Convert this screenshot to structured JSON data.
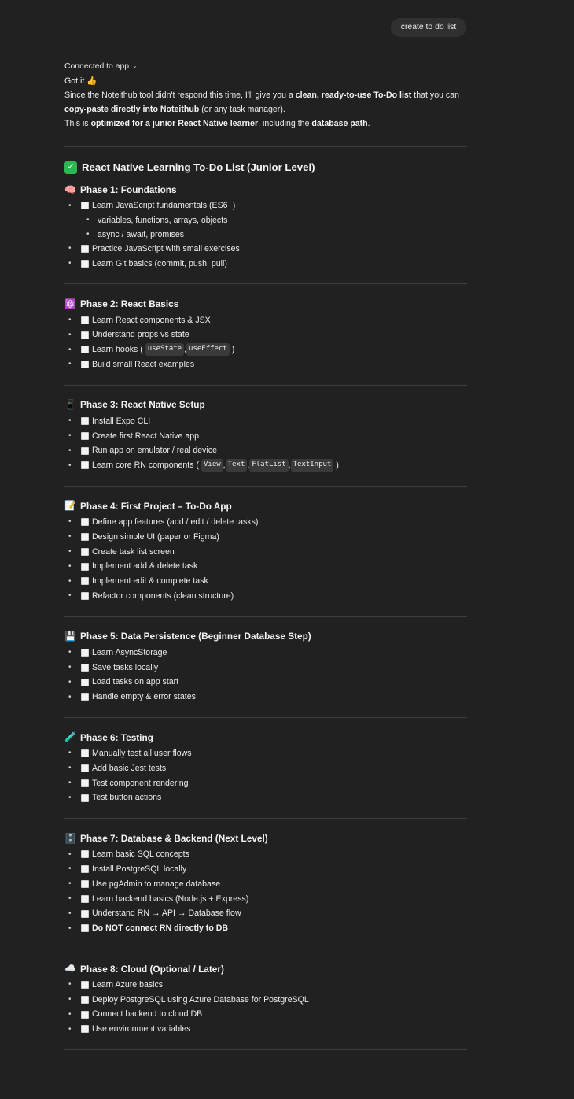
{
  "user_message": "create to do list",
  "assistant": {
    "connected_label": "Connected to app",
    "got_it": "Got it 👍",
    "intro_line1_a": "Since the Noteithub tool didn't respond this time, I'll give you a ",
    "intro_line1_b": "clean, ready-to-use To-Do list",
    "intro_line1_c": " that you can ",
    "intro_line1_d": "copy-paste directly into Noteithub",
    "intro_line1_e": " (or any task manager).",
    "intro_line2_a": "This is ",
    "intro_line2_b": "optimized for a junior React Native learner",
    "intro_line2_c": ", including the ",
    "intro_line2_d": "database path",
    "intro_line2_e": ".",
    "title": "React Native Learning To-Do List (Junior Level)"
  },
  "phases": [
    {
      "emoji": "🧠",
      "title": "Phase 1: Foundations"
    },
    {
      "emoji": "⚛️",
      "title": "Phase 2: React Basics"
    },
    {
      "emoji": "📱",
      "title": "Phase 3: React Native Setup"
    },
    {
      "emoji": "📝",
      "title": "Phase 4: First Project – To-Do App"
    },
    {
      "emoji": "💾",
      "title": "Phase 5: Data Persistence (Beginner Database Step)"
    },
    {
      "emoji": "🧪",
      "title": "Phase 6: Testing"
    },
    {
      "emoji": "🗄️",
      "title": "Phase 7: Database & Backend (Next Level)"
    },
    {
      "emoji": "☁️",
      "title": "Phase 8: Cloud (Optional / Later)"
    }
  ],
  "items": {
    "p1": [
      "Learn JavaScript fundamentals (ES6+)",
      "variables, functions, arrays, objects",
      "async / await, promises",
      "Practice JavaScript with small exercises",
      "Learn Git basics (commit, push, pull)"
    ],
    "p2": [
      "Learn React components & JSX",
      "Understand props vs state",
      "Learn hooks (",
      "useState",
      ", ",
      "useEffect",
      ")",
      "Build small React examples"
    ],
    "p3": [
      "Install Expo CLI",
      "Create first React Native app",
      "Run app on emulator / real device",
      "Learn core RN components (",
      "View",
      ", ",
      "Text",
      ", ",
      "FlatList",
      ", ",
      "TextInput",
      ")"
    ],
    "p4": [
      "Define app features (add / edit / delete tasks)",
      "Design simple UI (paper or Figma)",
      "Create task list screen",
      "Implement add & delete task",
      "Implement edit & complete task",
      "Refactor components (clean structure)"
    ],
    "p5": [
      "Learn AsyncStorage",
      "Save tasks locally",
      "Load tasks on app start",
      "Handle empty & error states"
    ],
    "p6": [
      "Manually test all user flows",
      "Add basic Jest tests",
      "Test component rendering",
      "Test button actions"
    ],
    "p7": [
      "Learn basic SQL concepts",
      "Install PostgreSQL locally",
      "Use pgAdmin to manage database",
      "Learn backend basics (Node.js + Express)",
      "Understand RN → API → Database flow",
      "Do NOT connect RN directly to DB"
    ],
    "p8": [
      "Learn Azure basics",
      "Deploy PostgreSQL using Azure Database for PostgreSQL",
      "Connect backend to cloud DB",
      "Use environment variables"
    ]
  }
}
